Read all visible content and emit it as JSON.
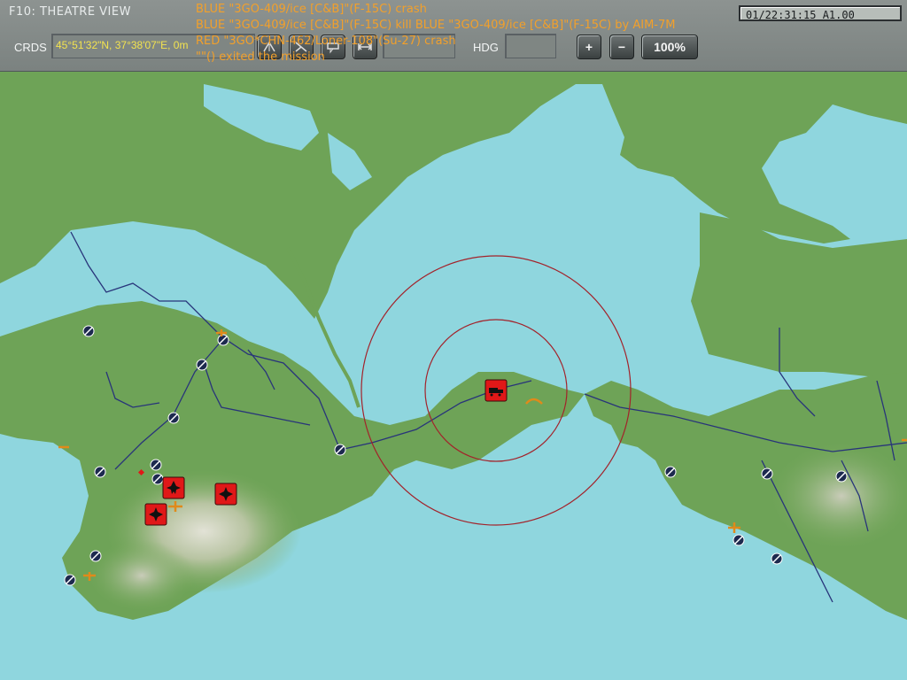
{
  "window": {
    "title": "F10: THEATRE VIEW",
    "clock": "01/22:31:15 A1.00"
  },
  "toolbar": {
    "crds_label": "CRDS",
    "crds_value": "45°51'32\"N, 37°38'07\"E, 0m",
    "hdg_label": "HDG",
    "hdg_value": "",
    "zoom_in": "+",
    "zoom_out": "−",
    "zoom_level": "100%",
    "tool_icons": [
      "radar-filter-icon",
      "sam-filter-icon",
      "label-toggle-icon",
      "ruler-icon"
    ]
  },
  "messages": [
    "BLUE \"3GO-409/ice [C&B]\"(F-15C) crash",
    "BLUE \"3GO-409/ice [C&B]\"(F-15C) kill BLUE \"3GO-409/ice [C&B]\"(F-15C) by AIM-7M",
    "RED \"3GO*CHN-462/Loner-108\"(Su-27) crash",
    "\"\"() exited the mission"
  ],
  "colors": {
    "water": "#8fd6de",
    "land": "#6ea357",
    "red_unit": "#e01818",
    "message_text": "#f2a02b",
    "coords_text": "#f3e34f",
    "range_ring": "#a3222a"
  }
}
